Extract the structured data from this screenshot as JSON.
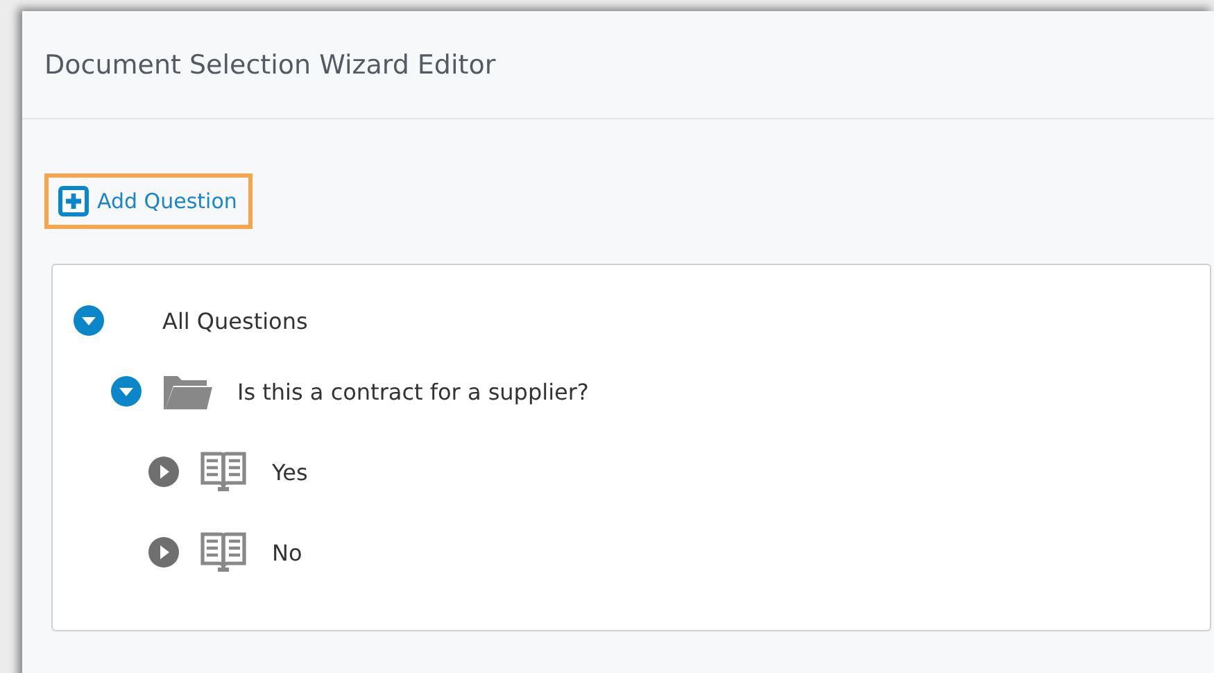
{
  "window": {
    "title": "Document Selection Wizard Editor"
  },
  "add_button": {
    "label": "Add Question"
  },
  "tree": [
    {
      "kind": "root",
      "label": "All Questions",
      "expanded": true,
      "children": [
        {
          "kind": "question",
          "label": "Is this a contract for a supplier?",
          "expanded": true,
          "children": [
            {
              "kind": "answer",
              "label": "Yes",
              "expanded": false
            },
            {
              "kind": "answer",
              "label": "No",
              "expanded": false
            }
          ]
        }
      ]
    }
  ]
}
